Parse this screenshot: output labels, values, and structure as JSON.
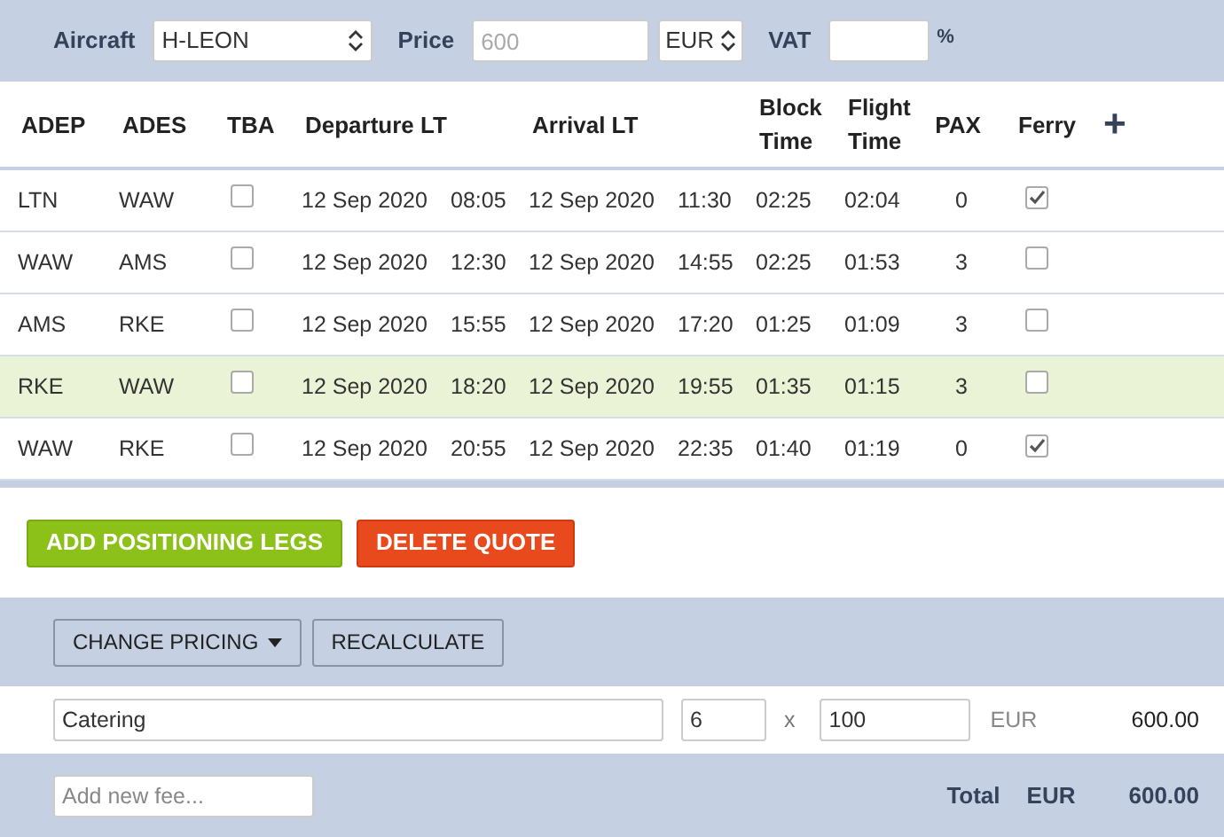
{
  "toolbar": {
    "aircraft_label": "Aircraft",
    "aircraft": "H-LEON",
    "price_label": "Price",
    "price_placeholder": "600",
    "currency": "EUR",
    "vat_label": "VAT",
    "vat_unit": "%"
  },
  "table": {
    "columns": [
      "ADEP",
      "ADES",
      "TBA",
      "Departure LT",
      "Arrival LT",
      "Block Time",
      "Flight Time",
      "PAX",
      "Ferry"
    ],
    "add_icon": "+",
    "rows": [
      {
        "adep": "LTN",
        "ades": "WAW",
        "tba": false,
        "dep_date": "12 Sep 2020",
        "dep_time": "08:05",
        "arr_date": "12 Sep 2020",
        "arr_time": "11:30",
        "block": "02:25",
        "flight": "02:04",
        "pax": "0",
        "ferry": true,
        "selected": false
      },
      {
        "adep": "WAW",
        "ades": "AMS",
        "tba": false,
        "dep_date": "12 Sep 2020",
        "dep_time": "12:30",
        "arr_date": "12 Sep 2020",
        "arr_time": "14:55",
        "block": "02:25",
        "flight": "01:53",
        "pax": "3",
        "ferry": false,
        "selected": false
      },
      {
        "adep": "AMS",
        "ades": "RKE",
        "tba": false,
        "dep_date": "12 Sep 2020",
        "dep_time": "15:55",
        "arr_date": "12 Sep 2020",
        "arr_time": "17:20",
        "block": "01:25",
        "flight": "01:09",
        "pax": "3",
        "ferry": false,
        "selected": false
      },
      {
        "adep": "RKE",
        "ades": "WAW",
        "tba": false,
        "dep_date": "12 Sep 2020",
        "dep_time": "18:20",
        "arr_date": "12 Sep 2020",
        "arr_time": "19:55",
        "block": "01:35",
        "flight": "01:15",
        "pax": "3",
        "ferry": false,
        "selected": true
      },
      {
        "adep": "WAW",
        "ades": "RKE",
        "tba": false,
        "dep_date": "12 Sep 2020",
        "dep_time": "20:55",
        "arr_date": "12 Sep 2020",
        "arr_time": "22:35",
        "block": "01:40",
        "flight": "01:19",
        "pax": "0",
        "ferry": true,
        "selected": false
      }
    ]
  },
  "actions": [
    "ADD POSITIONING LEGS",
    "DELETE QUOTE"
  ],
  "pricing_buttons": [
    "CHANGE PRICING",
    "RECALCULATE"
  ],
  "fees": [
    {
      "name": "Catering",
      "quantity": "6",
      "times": "x",
      "unit_price": "100",
      "currency": "EUR",
      "amount": "600.00"
    }
  ],
  "footer": {
    "new_fee_placeholder": "Add new fee...",
    "total_label": "Total",
    "currency": "EUR",
    "total": "600.00"
  }
}
